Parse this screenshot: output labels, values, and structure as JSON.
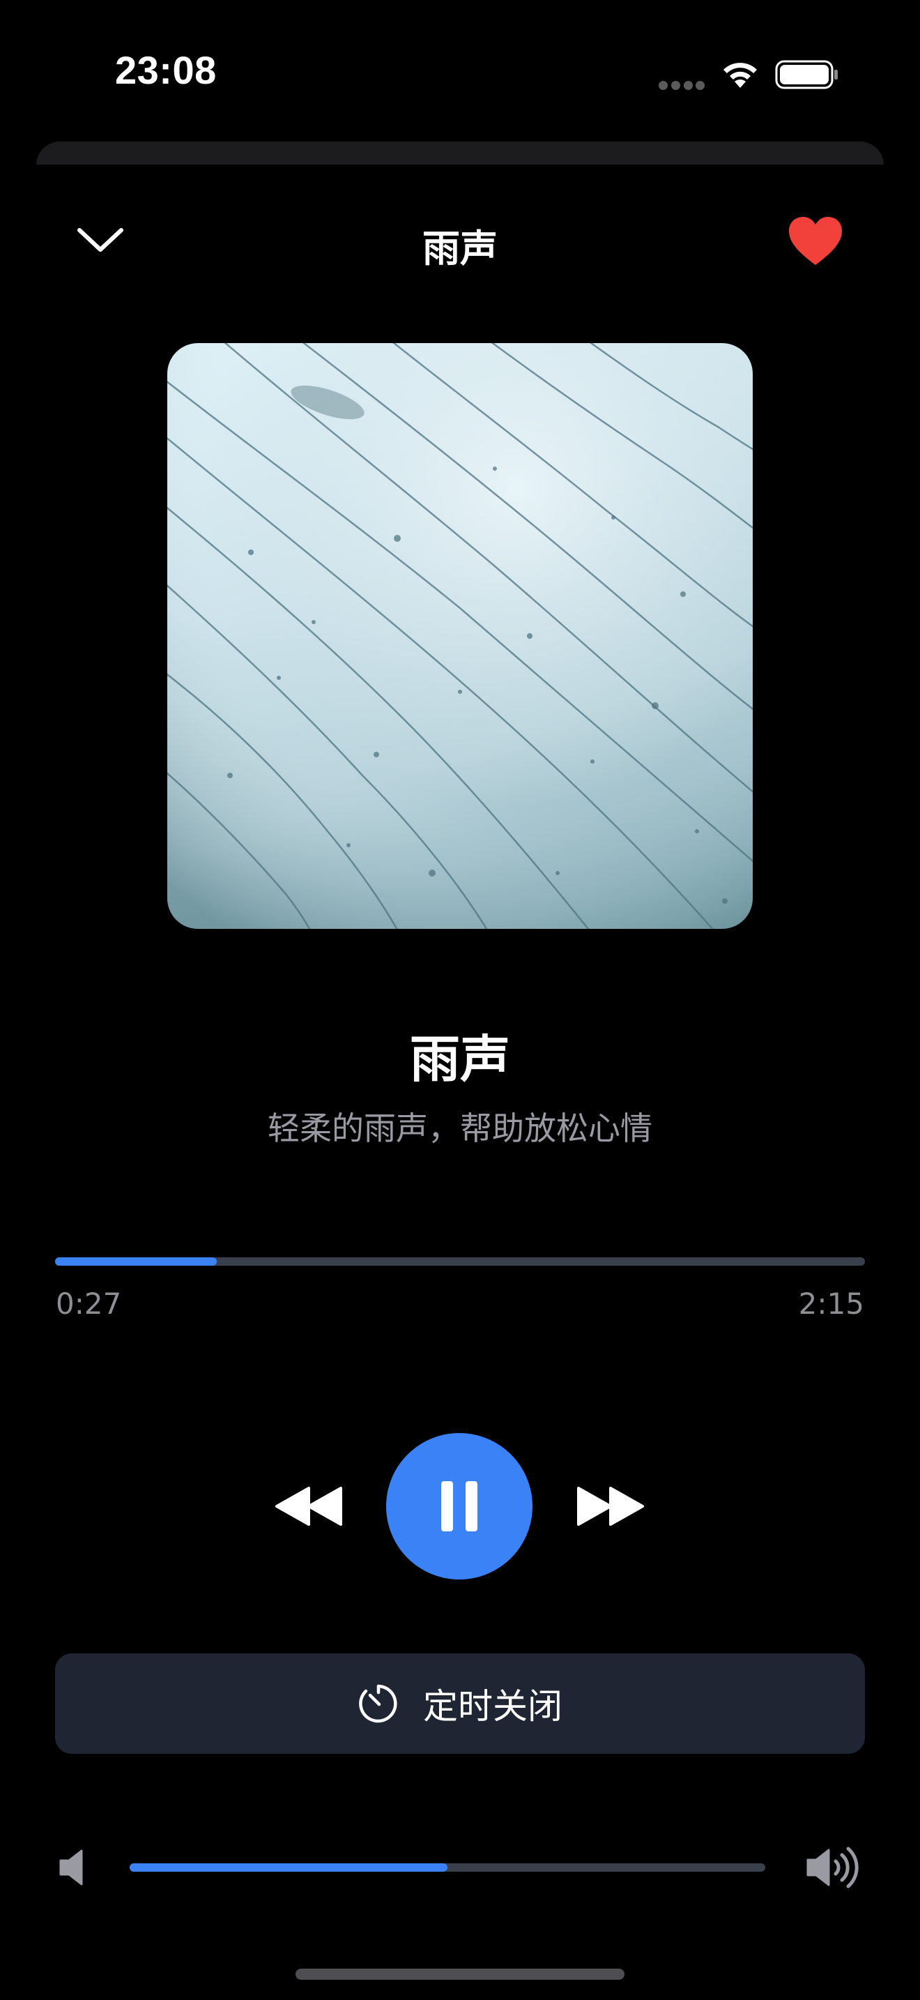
{
  "status_bar": {
    "time": "23:08"
  },
  "header": {
    "title": "雨声",
    "collapse_icon": "chevron-down-icon",
    "favorite_icon": "heart-icon",
    "favorite_color": "#f2413a"
  },
  "track": {
    "title": "雨声",
    "subtitle": "轻柔的雨声，帮助放松心情",
    "artwork_description_icon": "rain-artwork"
  },
  "progress": {
    "elapsed": "0:27",
    "total": "2:15",
    "fraction": 0.2
  },
  "controls": {
    "rewind_icon": "rewind-icon",
    "play_pause_icon": "pause-icon",
    "forward_icon": "fast-forward-icon"
  },
  "timer": {
    "label": "定时关闭",
    "icon": "timer-icon"
  },
  "volume": {
    "level": 0.5,
    "low_icon": "volume-low-icon",
    "high_icon": "volume-high-icon"
  },
  "colors": {
    "accent": "#3b82f6",
    "background": "#000000",
    "button_bg": "#1f2533",
    "track_bg": "#3a3f4c",
    "muted_text": "#8e8e93"
  }
}
